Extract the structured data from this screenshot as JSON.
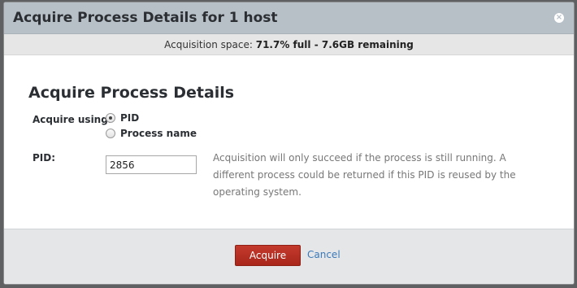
{
  "dialog": {
    "title": "Acquire Process Details for 1 host",
    "close_glyph": "×"
  },
  "space": {
    "label": "Acquisition space: ",
    "value": "71.7% full - 7.6GB remaining"
  },
  "form": {
    "heading": "Acquire Process Details",
    "acquire_using_label": "Acquire using:",
    "options": [
      {
        "label": "PID",
        "checked": true
      },
      {
        "label": "Process name",
        "checked": false
      }
    ],
    "pid_label": "PID:",
    "pid_value": "2856",
    "help_text": "Acquisition will only succeed if the process is still running. A different process could be returned if this PID is reused by the operating system."
  },
  "footer": {
    "acquire_label": "Acquire",
    "cancel_label": "Cancel"
  },
  "colors": {
    "acquire_button": "#b3291e",
    "link": "#3a79b8",
    "titlebar": "#b7bfc7"
  }
}
